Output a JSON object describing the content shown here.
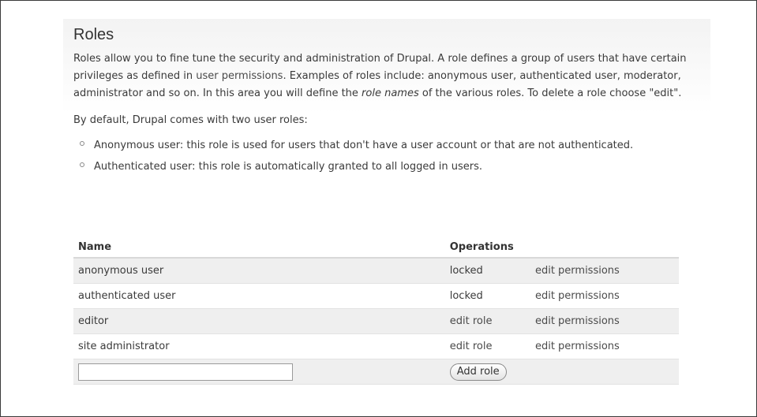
{
  "page": {
    "title": "Roles",
    "intro": {
      "part1": "Roles allow you to fine tune the security and administration of Drupal. A role defines a group of users that have certain privileges as defined in ",
      "link": "user permissions",
      "part2": ". Examples of roles include: anonymous user, authenticated user, moderator, administrator and so on. In this area you will define the ",
      "emphasis": "role names",
      "part3": " of the various roles. To delete a role choose \"edit\"."
    },
    "default_note": "By default, Drupal comes with two user roles:",
    "default_roles": [
      "Anonymous user: this role is used for users that don't have a user account or that are not authenticated.",
      "Authenticated user: this role is automatically granted to all logged in users."
    ]
  },
  "table": {
    "headers": {
      "name": "Name",
      "operations": "Operations"
    },
    "rows": [
      {
        "name": "anonymous user",
        "op1": "locked",
        "op2": "edit permissions"
      },
      {
        "name": "authenticated user",
        "op1": "locked",
        "op2": "edit permissions"
      },
      {
        "name": "editor",
        "op1": "edit role",
        "op2": "edit permissions"
      },
      {
        "name": "site administrator",
        "op1": "edit role",
        "op2": "edit permissions"
      }
    ],
    "new_role": {
      "value": "",
      "placeholder": "",
      "button_label": "Add role"
    }
  }
}
